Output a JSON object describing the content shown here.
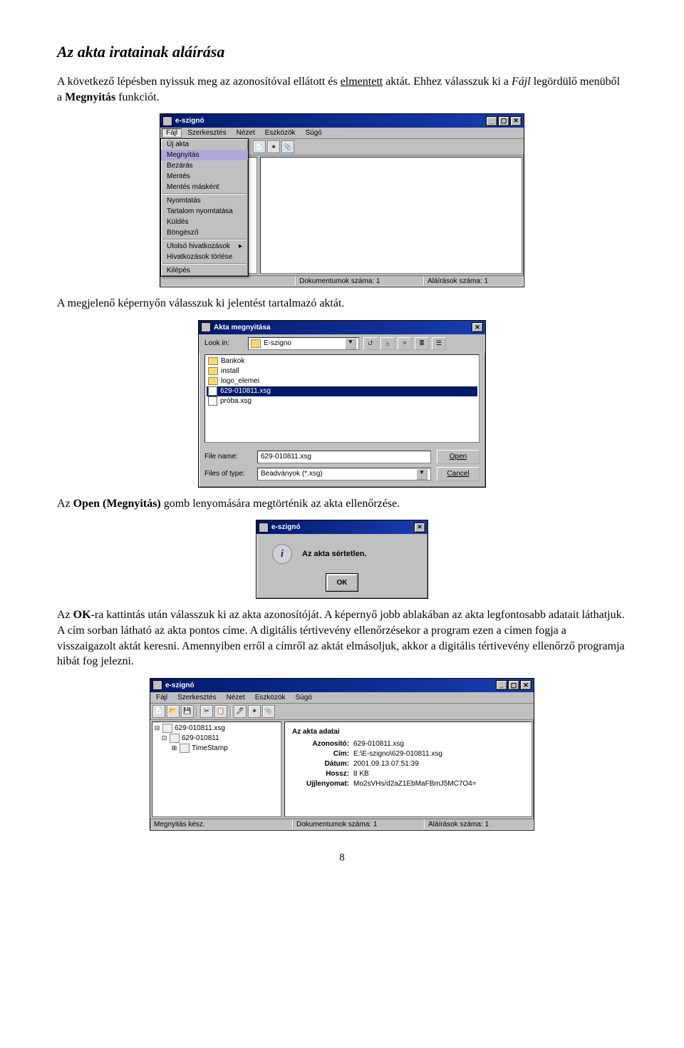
{
  "heading": "Az akta iratainak aláírása",
  "para1_a": "A következő lépésben nyissuk meg az azonosítóval ellátott és ",
  "para1_u": "elmentett",
  "para1_b": " aktát. Ehhez válasszuk ki a ",
  "para1_i": "Fájl",
  "para1_c": " legördülő menüből a ",
  "para1_bold1": "Megnyitás",
  "para1_d": " funkciót.",
  "shot1": {
    "title": "e-szignó",
    "menubar": [
      "Fájl",
      "Szerkesztés",
      "Nézet",
      "Eszközök",
      "Súgó"
    ],
    "menu": {
      "items": [
        "Új akta",
        "Megnyitás",
        "Bezárás",
        "Mentés",
        "Mentés másként",
        "Nyomtatás",
        "Tartalom nyomtatása",
        "Küldés",
        "Böngésző",
        "Utolsó hivatkozások",
        "Hivatkozások törlése",
        "Kilépés"
      ],
      "selected_index": 1,
      "submenu_index": 9
    },
    "status": {
      "c1": "",
      "c2": "Dokumentumok száma: 1",
      "c3": "Aláírások száma: 1"
    }
  },
  "para2": "A megjelenő képernyőn válasszuk ki jelentést tartalmazó aktát.",
  "shot2": {
    "title": "Akta megnyitása",
    "lookin_label": "Look in:",
    "lookin_value": "E-szigno",
    "files": [
      {
        "type": "folder",
        "name": "Bankok"
      },
      {
        "type": "folder",
        "name": "install"
      },
      {
        "type": "folder",
        "name": "logo_elemei"
      },
      {
        "type": "file",
        "name": "629-010811.xsg",
        "selected": true
      },
      {
        "type": "file",
        "name": "próba.xsg"
      }
    ],
    "filename_label": "File name:",
    "filename_value": "629-010811.xsg",
    "filetype_label": "Files of type:",
    "filetype_value": "Beadványok (*.xsg)",
    "open_btn": "Open",
    "cancel_btn": "Cancel"
  },
  "para3_a": "Az ",
  "para3_b1": "Open (Megnyitás)",
  "para3_b": " gomb lenyomására megtörténik az akta ellenőrzése.",
  "shot3": {
    "title": "e-szignó",
    "msg": "Az akta sértetlen.",
    "ok": "OK"
  },
  "para4_a": "Az ",
  "para4_b1": "OK",
  "para4_b": "-ra kattintás után válasszuk ki az akta azonosítóját. A képernyő jobb ablakában az akta legfontosabb adatait láthatjuk. A cím sorban látható az akta pontos címe. A digitális tértivevény ellenőrzésekor a program ezen a címen fogja a visszaigazolt aktát keresni. Amennyiben erről a címről az aktát elmásoljuk, akkor a digitális tértivevény ellenőrző programja hibát fog jelezni.",
  "shot4": {
    "title": "e-szignó",
    "menubar": [
      "Fájl",
      "Szerkesztés",
      "Nézet",
      "Eszközök",
      "Súgó"
    ],
    "tree": {
      "root": "629-010811.xsg",
      "n1": "629-010811",
      "n2": "TimeStamp"
    },
    "panel_title": "Az akta adatai",
    "kv": [
      {
        "k": "Azonosító:",
        "v": "629-010811.xsg"
      },
      {
        "k": "Cím:",
        "v": "E:\\E-szigno\\629-010811.xsg"
      },
      {
        "k": "Dátum:",
        "v": "2001.09.13 07:51:39"
      },
      {
        "k": "Hossz:",
        "v": "8 KB"
      },
      {
        "k": "Ujjlenyomat:",
        "v": "Mo2sVHs/d2aZ1EbMaFBmJ5MC7O4="
      }
    ],
    "status": {
      "c1": "Megnyitás kész.",
      "c2": "Dokumentumok száma: 1",
      "c3": "Aláírások száma: 1"
    }
  },
  "page_num": "8"
}
